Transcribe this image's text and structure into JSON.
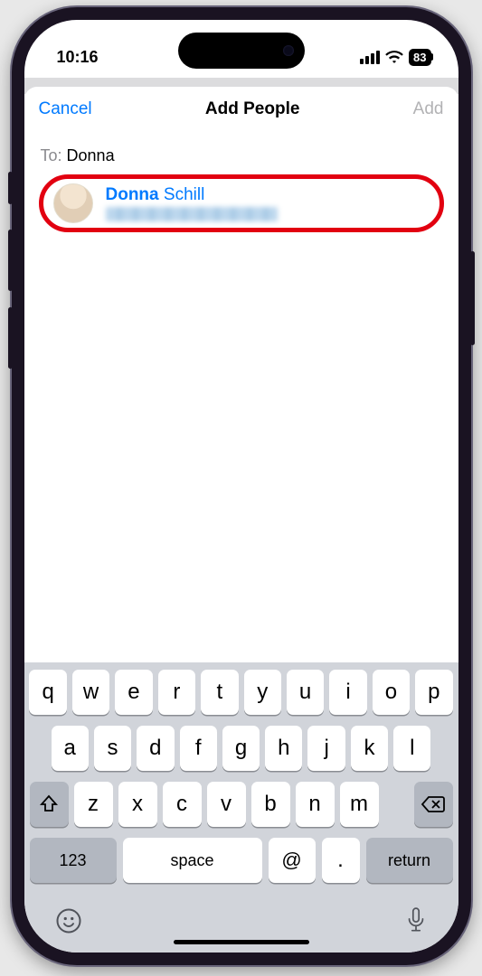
{
  "status": {
    "time": "10:16",
    "battery": "83"
  },
  "header": {
    "cancel": "Cancel",
    "title": "Add People",
    "add": "Add"
  },
  "to": {
    "label": "To:",
    "value": "Donna"
  },
  "contact": {
    "first": "Donna",
    "last": "Schill"
  },
  "keyboard": {
    "row1": [
      "q",
      "w",
      "e",
      "r",
      "t",
      "y",
      "u",
      "i",
      "o",
      "p"
    ],
    "row2": [
      "a",
      "s",
      "d",
      "f",
      "g",
      "h",
      "j",
      "k",
      "l"
    ],
    "row3": [
      "z",
      "x",
      "c",
      "v",
      "b",
      "n",
      "m"
    ],
    "numbers": "123",
    "space": "space",
    "at": "@",
    "dot": ".",
    "ret": "return"
  }
}
